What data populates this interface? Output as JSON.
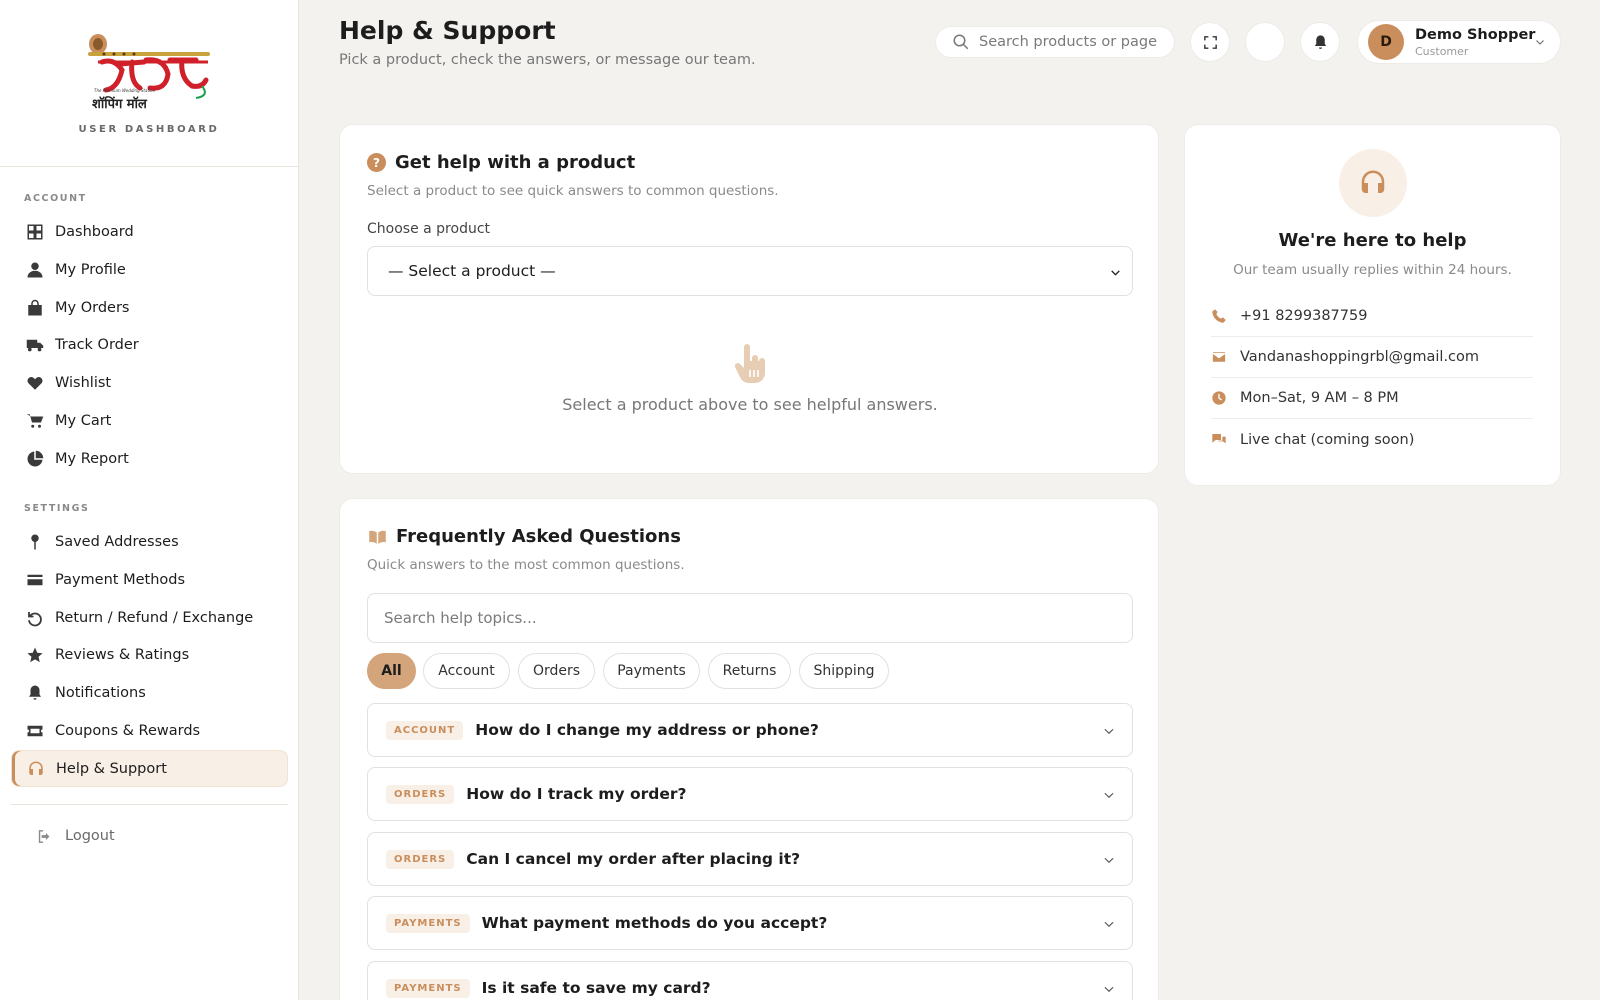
{
  "brand": {
    "logo_text": "वन्दना",
    "logo_tagline": "The Premium Wedding Station",
    "logo_sub": "शॉपिंग मॉल",
    "dashboard_label": "USER DASHBOARD"
  },
  "sidebar": {
    "account_heading": "ACCOUNT",
    "account_items": [
      {
        "label": "Dashboard",
        "icon": "grid-icon"
      },
      {
        "label": "My Profile",
        "icon": "user-icon"
      },
      {
        "label": "My Orders",
        "icon": "bag-icon"
      },
      {
        "label": "Track Order",
        "icon": "truck-icon"
      },
      {
        "label": "Wishlist",
        "icon": "heart-icon"
      },
      {
        "label": "My Cart",
        "icon": "cart-icon"
      },
      {
        "label": "My Report",
        "icon": "pie-chart-icon"
      }
    ],
    "settings_heading": "SETTINGS",
    "settings_items": [
      {
        "label": "Saved Addresses",
        "icon": "pin-icon"
      },
      {
        "label": "Payment Methods",
        "icon": "credit-card-icon"
      },
      {
        "label": "Return / Refund / Exchange",
        "icon": "undo-icon"
      },
      {
        "label": "Reviews & Ratings",
        "icon": "star-icon"
      },
      {
        "label": "Notifications",
        "icon": "bell-icon"
      },
      {
        "label": "Coupons & Rewards",
        "icon": "ticket-icon"
      },
      {
        "label": "Help & Support",
        "icon": "headset-icon",
        "active": true
      }
    ],
    "logout_label": "Logout"
  },
  "header": {
    "title": "Help & Support",
    "subtitle": "Pick a product, check the answers, or message our team.",
    "search_placeholder": "Search products or page",
    "user_name": "Demo Shopper",
    "user_role": "Customer",
    "user_initial": "D"
  },
  "product_help": {
    "title": "Get help with a product",
    "subtitle": "Select a product to see quick answers to common questions.",
    "choose_label": "Choose a product",
    "select_value": "— Select a product —",
    "hint": "Select a product above to see helpful answers."
  },
  "faq": {
    "title": "Frequently Asked Questions",
    "subtitle": "Quick answers to the most common questions.",
    "search_placeholder": "Search help topics...",
    "filters": [
      "All",
      "Account",
      "Orders",
      "Payments",
      "Returns",
      "Shipping"
    ],
    "active_filter": "All",
    "questions": [
      {
        "tag": "ACCOUNT",
        "question": "How do I change my address or phone?"
      },
      {
        "tag": "ORDERS",
        "question": "How do I track my order?"
      },
      {
        "tag": "ORDERS",
        "question": "Can I cancel my order after placing it?"
      },
      {
        "tag": "PAYMENTS",
        "question": "What payment methods do you accept?"
      },
      {
        "tag": "PAYMENTS",
        "question": "Is it safe to save my card?"
      }
    ]
  },
  "support": {
    "title": "We're here to help",
    "subtitle": "Our team usually replies within 24 hours.",
    "contacts": [
      {
        "icon": "phone-icon",
        "text": "+91 8299387759"
      },
      {
        "icon": "mail-icon",
        "text": "Vandanashoppingrbl@gmail.com"
      },
      {
        "icon": "clock-icon",
        "text": "Mon–Sat, 9 AM – 8 PM"
      },
      {
        "icon": "chat-icon",
        "text": "Live chat (coming soon)"
      }
    ]
  },
  "colors": {
    "accent": "#c98e5c",
    "accent_light": "#f8efe6",
    "chip_active": "#d4a47a",
    "background": "#f3f2ef"
  }
}
